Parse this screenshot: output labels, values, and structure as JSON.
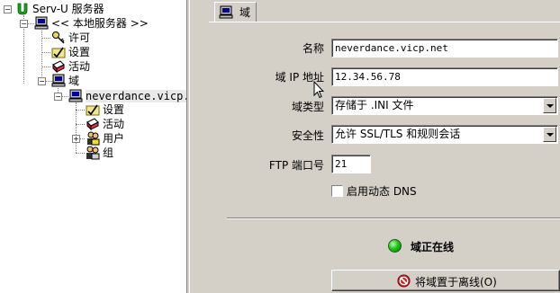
{
  "tree": {
    "root": "Serv-U 服务器",
    "local_server": "<< 本地服务器 >>",
    "license": "许可",
    "settings": "设置",
    "activity": "活动",
    "domains": "域",
    "domain_name": "neverdance.vicp.net",
    "domain_settings": "设置",
    "domain_activity": "活动",
    "users": "用户",
    "groups": "组"
  },
  "tab": {
    "label": "域"
  },
  "form": {
    "name_label": "名称",
    "name_value": "neverdance.vicp.net",
    "ip_label": "域 IP 地址",
    "ip_value": "12.34.56.78",
    "type_label": "域类型",
    "type_value": "存储于 .INI 文件",
    "security_label": "安全性",
    "security_value": "允许 SSL/TLS 和规则会话",
    "port_label": "FTP 端口号",
    "port_value": "21",
    "dynamic_dns_label": "启用动态 DNS",
    "dynamic_dns_checked": false
  },
  "status": {
    "text": "域正在线",
    "indicator_color": "#22c41a"
  },
  "offline_button": {
    "label": "将域置于离线(O)"
  },
  "icons": [
    "serv-u-logo-icon",
    "computer-icon",
    "key-icon",
    "settings-icon",
    "activity-icon",
    "domain-icon",
    "users-icon",
    "groups-icon",
    "stop-icon",
    "pointer-cursor-icon"
  ]
}
